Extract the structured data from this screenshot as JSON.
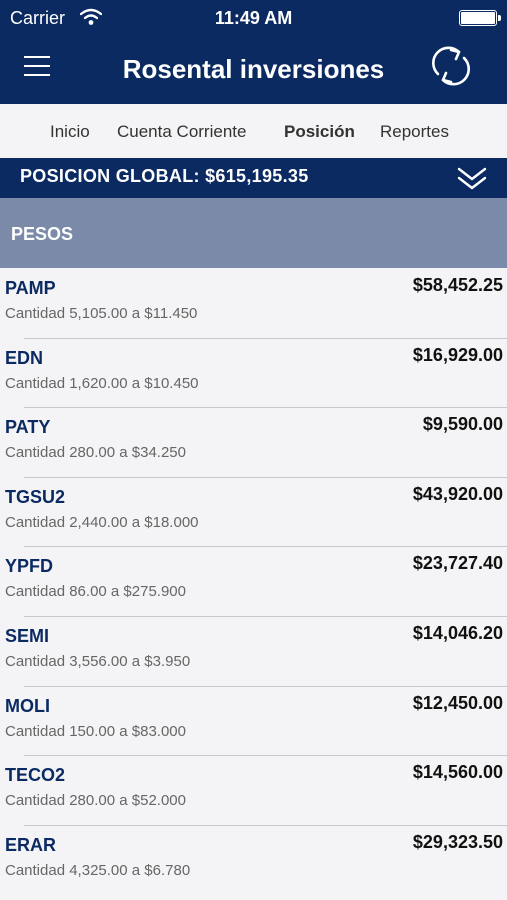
{
  "status_bar": {
    "carrier": "Carrier",
    "time": "11:49 AM"
  },
  "header": {
    "title": "Rosental inversiones"
  },
  "tabs": [
    {
      "label": "Inicio",
      "active": false
    },
    {
      "label": "Cuenta Corriente",
      "active": false
    },
    {
      "label": "Posición",
      "active": true
    },
    {
      "label": "Reportes",
      "active": false
    }
  ],
  "global": {
    "label": "POSICION GLOBAL: $615,195.35"
  },
  "section": {
    "label": "PESOS"
  },
  "positions": [
    {
      "symbol": "PAMP",
      "amount": "$58,452.25",
      "detail": "Cantidad 5,105.00 a $11.450"
    },
    {
      "symbol": "EDN",
      "amount": "$16,929.00",
      "detail": "Cantidad 1,620.00 a $10.450"
    },
    {
      "symbol": "PATY",
      "amount": "$9,590.00",
      "detail": "Cantidad 280.00 a $34.250"
    },
    {
      "symbol": "TGSU2",
      "amount": "$43,920.00",
      "detail": "Cantidad 2,440.00 a $18.000"
    },
    {
      "symbol": "YPFD",
      "amount": "$23,727.40",
      "detail": "Cantidad 86.00 a $275.900"
    },
    {
      "symbol": "SEMI",
      "amount": "$14,046.20",
      "detail": "Cantidad 3,556.00 a $3.950"
    },
    {
      "symbol": "MOLI",
      "amount": "$12,450.00",
      "detail": "Cantidad 150.00 a $83.000"
    },
    {
      "symbol": "TECO2",
      "amount": "$14,560.00",
      "detail": "Cantidad 280.00 a $52.000"
    },
    {
      "symbol": "ERAR",
      "amount": "$29,323.50",
      "detail": "Cantidad 4,325.00 a $6.780"
    }
  ],
  "icons": {
    "menu": "hamburger-menu-icon",
    "refresh": "refresh-icon",
    "expand": "double-chevron-down-icon",
    "wifi": "wifi-icon",
    "battery": "battery-icon"
  },
  "colors": {
    "header": "#0b2a62",
    "section": "#7a8aa8",
    "background": "#f4f4f6"
  }
}
